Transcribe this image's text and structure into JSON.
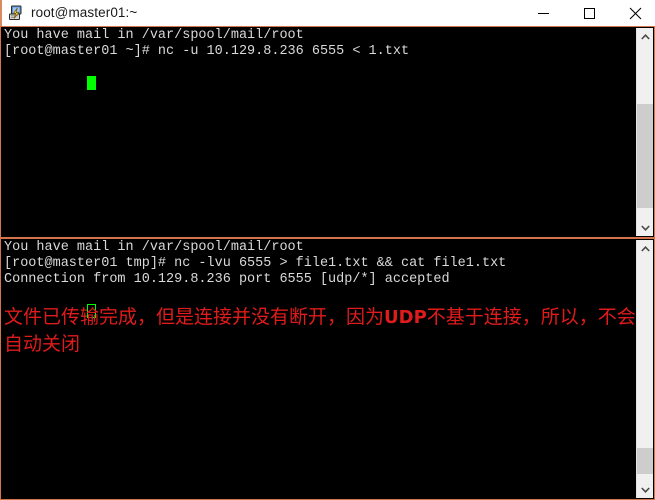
{
  "window": {
    "title": "root@master01:~",
    "icon": "putty-icon",
    "controls": {
      "minimize_label": "—",
      "maximize_label": "□",
      "close_label": "✕"
    }
  },
  "panes": [
    {
      "id": "top",
      "role": "udp-client-session",
      "lines": [
        "You have mail in /var/spool/mail/root",
        "[root@master01 ~]# nc -u 10.129.8.236 6555 < 1.txt"
      ],
      "cursor": "filled",
      "scrollbar": {
        "up_arrow": "chevron-up-icon",
        "down_arrow": "chevron-down-icon"
      }
    },
    {
      "id": "bottom",
      "role": "udp-listener-session",
      "lines": [
        "You have mail in /var/spool/mail/root",
        "[root@master01 tmp]# nc -lvu 6555 > file1.txt && cat file1.txt",
        "Connection from 10.129.8.236 port 6555 [udp/*] accepted"
      ],
      "cursor": "hollow",
      "annotation_prefix": "文件已传输完成，但是连接并没有断开，因为",
      "annotation_latin": "UDP",
      "annotation_suffix": "不基于连接，所以，不会自动关闭",
      "scrollbar": {
        "up_arrow": "chevron-up-icon",
        "down_arrow": "chevron-down-icon"
      }
    }
  ],
  "colors": {
    "terminal_background": "#000000",
    "terminal_foreground": "#d9d9d9",
    "pane_border": "#d4744a",
    "cursor": "#00ff00",
    "annotation": "#e01b1b",
    "scrollbar_track": "#f0f0f0",
    "scrollbar_thumb": "#cdcdcd"
  }
}
